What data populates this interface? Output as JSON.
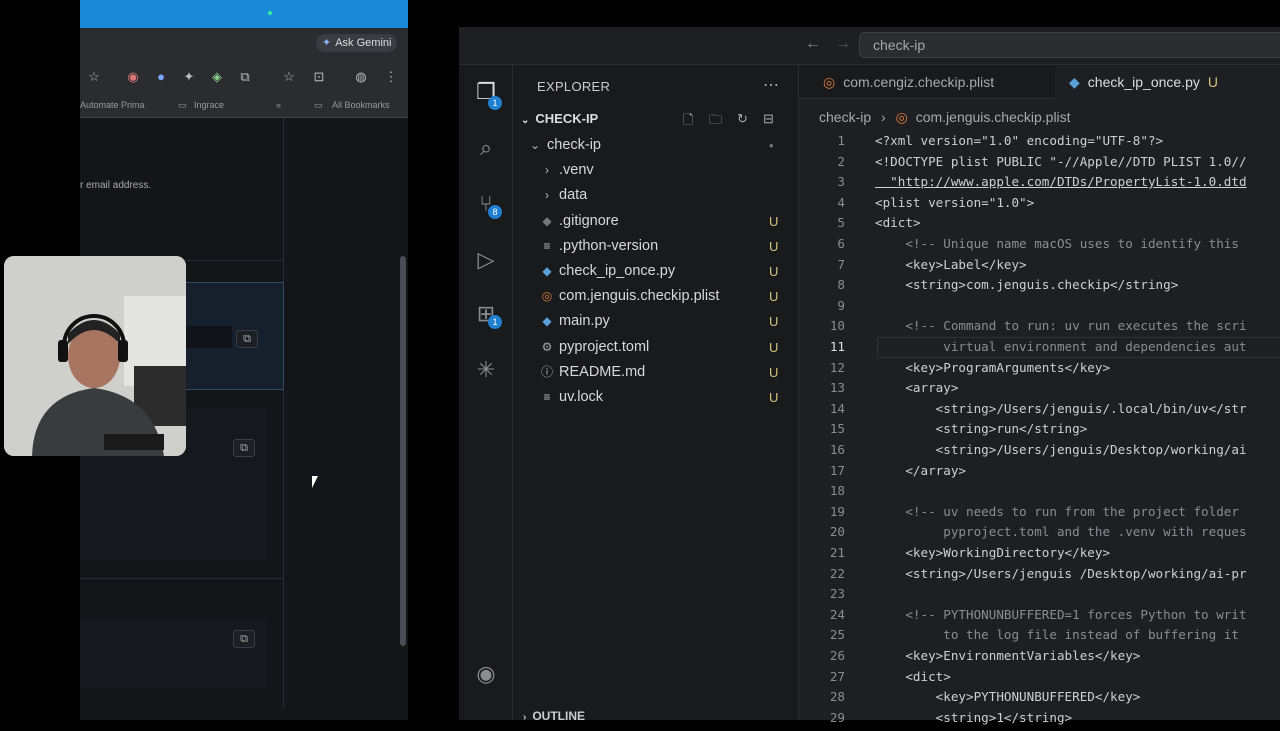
{
  "browser": {
    "ask_gemini": "Ask Gemini",
    "bookmarks": [
      "Automate Prima",
      "Ingrace",
      "»",
      "All Bookmarks"
    ],
    "hint_text": "r email address."
  },
  "vscode": {
    "command_center": "check-ip",
    "explorer_title": "EXPLORER",
    "section": "CHECK-IP",
    "tree": [
      {
        "label": "check-ip",
        "type": "folder-open",
        "status": "•"
      },
      {
        "label": ".venv",
        "type": "folder",
        "status": ""
      },
      {
        "label": "data",
        "type": "folder",
        "status": ""
      },
      {
        "label": ".gitignore",
        "type": "git",
        "status": "U"
      },
      {
        "label": ".python-version",
        "type": "text",
        "status": "U"
      },
      {
        "label": "check_ip_once.py",
        "type": "python",
        "status": "U"
      },
      {
        "label": "com.jenguis.checkip.plist",
        "type": "rss",
        "status": "U"
      },
      {
        "label": "main.py",
        "type": "python",
        "status": "U"
      },
      {
        "label": "pyproject.toml",
        "type": "gear",
        "status": "U"
      },
      {
        "label": "README.md",
        "type": "info",
        "status": "U"
      },
      {
        "label": "uv.lock",
        "type": "text",
        "status": "U"
      }
    ],
    "outline": "OUTLINE",
    "tabs": [
      {
        "label": "com.cengiz.checkip.plist",
        "status": "",
        "active": false
      },
      {
        "label": "check_ip_once.py",
        "status": "U",
        "active": true
      }
    ],
    "breadcrumb": [
      "check-ip",
      "com.jenguis.checkip.plist"
    ],
    "badges": {
      "explorer": "1",
      "scm": "8",
      "extensions": "1"
    },
    "code_lines": [
      "<?xml version=\"1.0\" encoding=\"UTF-8\"?>",
      "<!DOCTYPE plist PUBLIC \"-//Apple//DTD PLIST 1.0//",
      "  \"http://www.apple.com/DTDs/PropertyList-1.0.dtd",
      "<plist version=\"1.0\">",
      "<dict>",
      "    <!-- Unique name macOS uses to identify this",
      "    <key>Label</key>",
      "    <string>com.jenguis.checkip</string>",
      "",
      "    <!-- Command to run: uv run executes the scri",
      "         virtual environment and dependencies aut",
      "    <key>ProgramArguments</key>",
      "    <array>",
      "        <string>/Users/jenguis/.local/bin/uv</str",
      "        <string>run</string>",
      "        <string>/Users/jenguis/Desktop/working/ai",
      "    </array>",
      "",
      "    <!-- uv needs to run from the project folder",
      "         pyproject.toml and the .venv with reques",
      "    <key>WorkingDirectory</key>",
      "    <string>/Users/jenguis /Desktop/working/ai-pr",
      "",
      "    <!-- PYTHONUNBUFFERED=1 forces Python to writ",
      "         to the log file instead of buffering it",
      "    <key>EnvironmentVariables</key>",
      "    <dict>",
      "        <key>PYTHONUNBUFFERED</key>",
      "        <string>1</string>"
    ],
    "active_line": 11
  }
}
